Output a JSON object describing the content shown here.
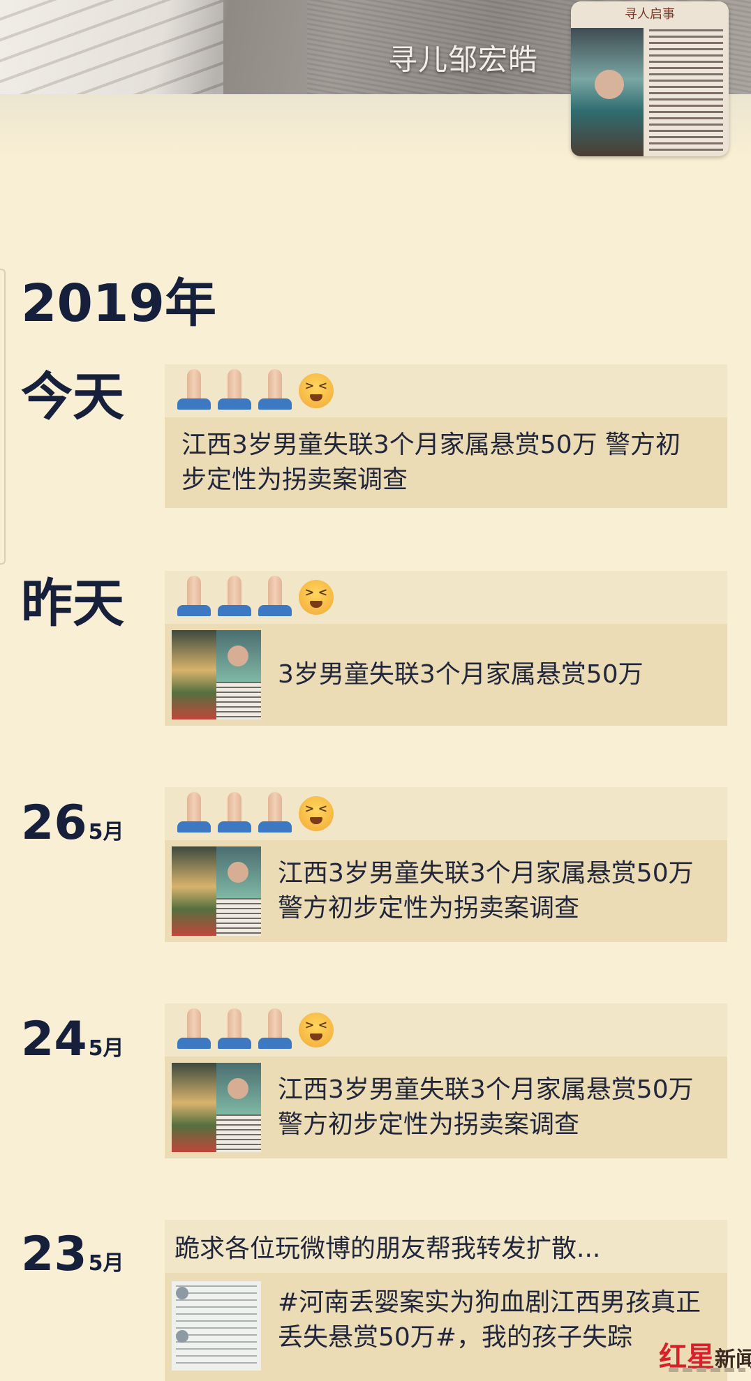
{
  "profile": {
    "nickname": "寻儿邹宏皓",
    "avatar_poster_title": "寻人启事"
  },
  "timeline": {
    "year": "2019年",
    "entries": [
      {
        "day": "今天",
        "month": "",
        "emojis": [
          "folded-hands",
          "folded-hands",
          "folded-hands",
          "crying-face"
        ],
        "share_text": "江西3岁男童失联3个月家属悬赏50万 警方初步定性为拐卖案调查",
        "has_thumb": false
      },
      {
        "day": "昨天",
        "month": "",
        "emojis": [
          "folded-hands",
          "folded-hands",
          "folded-hands",
          "crying-face"
        ],
        "share_text": "3岁男童失联3个月家属悬赏50万",
        "has_thumb": true
      },
      {
        "day": "26",
        "month": "5月",
        "emojis": [
          "folded-hands",
          "folded-hands",
          "folded-hands",
          "crying-face"
        ],
        "share_text": "江西3岁男童失联3个月家属悬赏50万 警方初步定性为拐卖案调查",
        "has_thumb": true
      },
      {
        "day": "24",
        "month": "5月",
        "emojis": [
          "folded-hands",
          "folded-hands",
          "folded-hands",
          "crying-face"
        ],
        "share_text": "江西3岁男童失联3个月家属悬赏50万 警方初步定性为拐卖案调查",
        "has_thumb": true
      },
      {
        "day": "23",
        "month": "5月",
        "post_text": "跪求各位玩微博的朋友帮我转发扩散...",
        "share_text": "#河南丢婴案实为狗血剧江西男孩真正丢失悬赏50万#，我的孩子失踪",
        "has_thumb": true
      }
    ]
  },
  "watermark": {
    "red_part": "红星",
    "dark_part": "新闻"
  }
}
